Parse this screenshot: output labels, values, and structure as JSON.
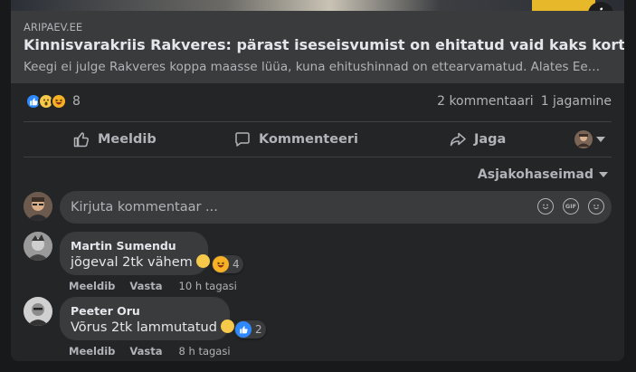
{
  "post": {
    "link_domain": "ARIPAEV.EE",
    "link_title": "Kinnisvarakriis Rakveres: pärast iseseisvumist on ehitatud vaid kaks korterelamut",
    "link_excerpt": "Keegi ei julge Rakveres koppa maasse lüüa, kuna ehitushinnad on ettearvamatud. Alates Eesti t…",
    "info_icon": "i"
  },
  "stats": {
    "reactions": [
      "like",
      "wow",
      "haha"
    ],
    "reaction_count": "8",
    "comments": "2 kommentaari",
    "shares": "1 jagamine"
  },
  "actions": {
    "like": "Meeldib",
    "comment": "Kommenteeri",
    "share": "Jaga"
  },
  "sort": {
    "label": "Asjakohaseimad"
  },
  "composer": {
    "placeholder": "Kirjuta kommentaar ...",
    "icons": [
      "emoji-icon",
      "gif-icon",
      "sticker-icon"
    ],
    "gif_label": "GIF"
  },
  "comments": [
    {
      "author": "Martin Sumendu",
      "text": "jõgeval 2tk vähem",
      "reactions": [
        "haha"
      ],
      "reaction_count": "4",
      "like": "Meeldib",
      "reply": "Vasta",
      "time": "10 h tagasi"
    },
    {
      "author": "Peeter Oru",
      "text": "Võrus 2tk lammutatud",
      "reactions": [
        "like"
      ],
      "reaction_count": "2",
      "like": "Meeldib",
      "reply": "Vasta",
      "time": "8 h tagasi"
    }
  ],
  "colors": {
    "card_bg": "#242526",
    "bubble_bg": "#3a3b3c",
    "secondary_text": "#b0b3b8",
    "like_blue": "#2e89ff"
  }
}
